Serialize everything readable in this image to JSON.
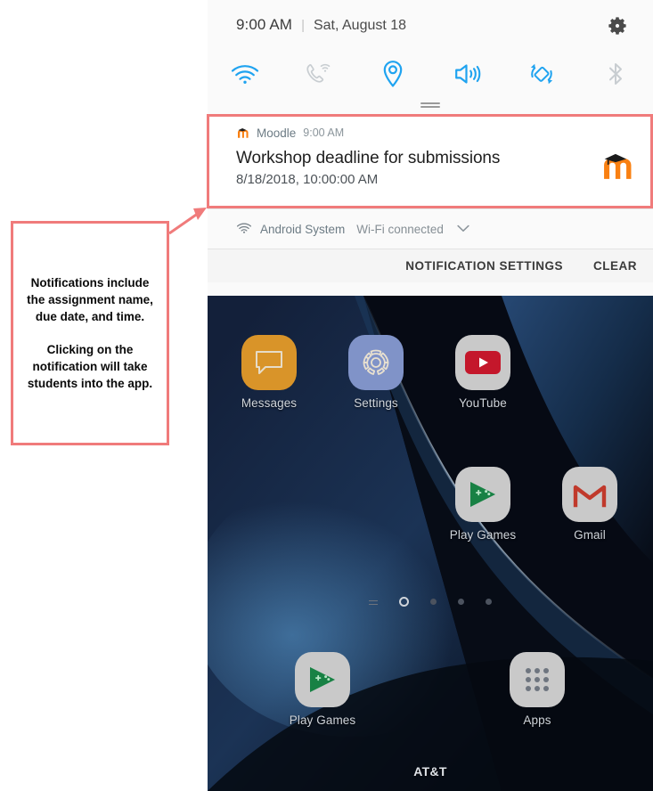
{
  "statusbar": {
    "time": "9:00 AM",
    "separator": "|",
    "date": "Sat, August 18",
    "gear_icon": "gear-icon"
  },
  "quick_toggles": [
    {
      "name": "wifi-toggle",
      "icon": "wifi-icon",
      "label": "Wi-Fi",
      "state": "on",
      "color": "#1fa3f0"
    },
    {
      "name": "wifi-calling-toggle",
      "icon": "phone-wifi-icon",
      "label": "Wi-Fi calling",
      "state": "off",
      "color": "#c8cdd1"
    },
    {
      "name": "location-toggle",
      "icon": "location-pin-icon",
      "label": "Location",
      "state": "on",
      "color": "#1fa3f0"
    },
    {
      "name": "sound-toggle",
      "icon": "speaker-icon",
      "label": "Sound",
      "state": "on",
      "color": "#1fa3f0"
    },
    {
      "name": "auto-rotate-toggle",
      "icon": "auto-rotate-icon",
      "label": "Auto rotate",
      "state": "on",
      "color": "#1fa3f0"
    },
    {
      "name": "bluetooth-toggle",
      "icon": "bluetooth-icon",
      "label": "Bluetooth",
      "state": "off",
      "color": "#c8cdd1"
    }
  ],
  "notification": {
    "app_icon": "moodle-icon",
    "app_name": "Moodle",
    "time": "9:00 AM",
    "title": "Workshop deadline for submissions",
    "subtitle": "8/18/2018, 10:00:00 AM",
    "large_icon": "moodle-icon"
  },
  "notification_secondary": {
    "icon": "wifi-icon",
    "app_name": "Android System",
    "status": "Wi-Fi connected",
    "expand_icon": "chevron-down-icon"
  },
  "notification_actions": {
    "settings_label": "NOTIFICATION SETTINGS",
    "clear_label": "CLEAR"
  },
  "home_screen": {
    "row1": [
      {
        "name": "app-messages",
        "label": "Messages",
        "icon": "chat-bubble-icon",
        "bg": "#d99429"
      },
      {
        "name": "app-settings",
        "label": "Settings",
        "icon": "gear-icon",
        "bg": "#8093c8"
      },
      {
        "name": "app-youtube",
        "label": "YouTube",
        "icon": "youtube-icon",
        "bg": "#c9c9c9"
      }
    ],
    "row2": [
      {
        "name": "app-play-games",
        "label": "Play Games",
        "icon": "play-games-icon",
        "bg": "#c9c9c9"
      },
      {
        "name": "app-gmail",
        "label": "Gmail",
        "icon": "gmail-icon",
        "bg": "#c9c9c9"
      }
    ],
    "dock": [
      {
        "name": "dock-play-games",
        "label": "Play Games",
        "icon": "play-games-icon",
        "bg": "#c9c9c9"
      },
      {
        "name": "dock-apps",
        "label": "Apps",
        "icon": "app-grid-icon",
        "bg": "#c9c9c9"
      }
    ],
    "page_indicator": {
      "pages": 4,
      "active_index": 0,
      "home_marker": true
    },
    "carrier": "AT&T"
  },
  "annotation": {
    "paragraph1": "Notifications include the assignment name, due date, and time.",
    "paragraph2": "Clicking on the notification will take students into the app.",
    "accent_color": "#f07b7b"
  }
}
